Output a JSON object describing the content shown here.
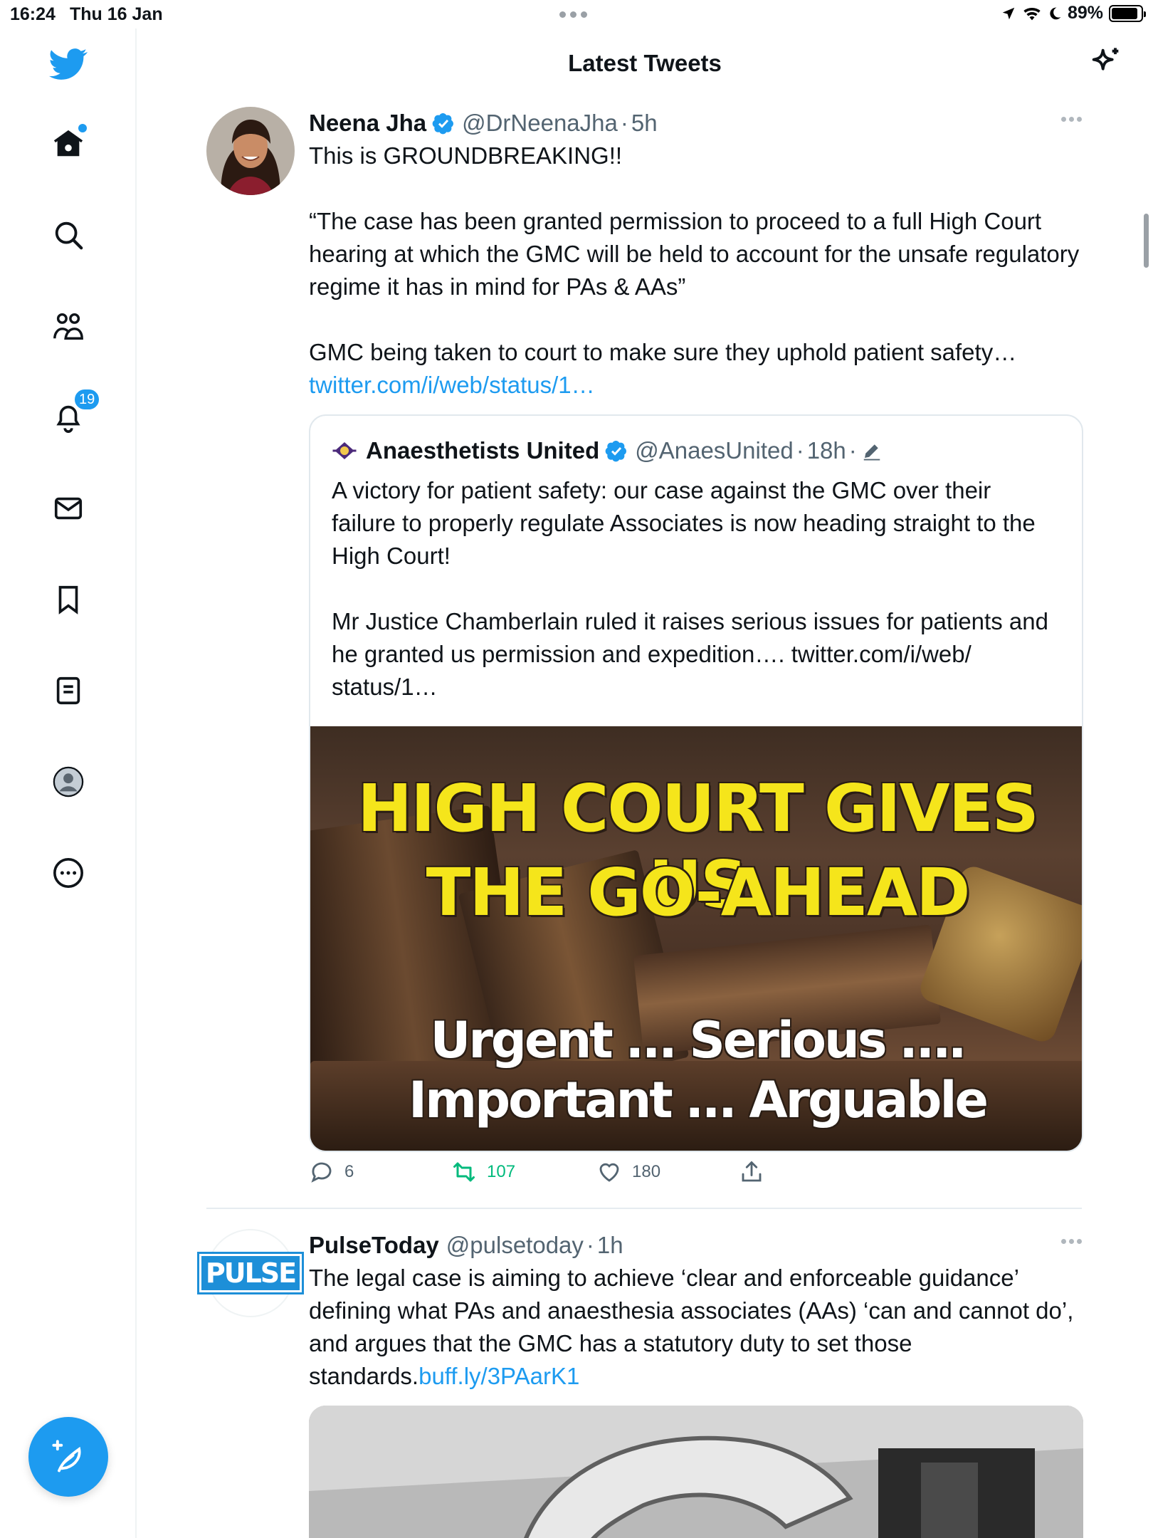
{
  "status_bar": {
    "time": "16:24",
    "date": "Thu 16 Jan",
    "battery": "89%",
    "battery_level": 0.89
  },
  "header": {
    "title": "Latest Tweets"
  },
  "sidebar": {
    "items": [
      {
        "name": "home",
        "icon": "home-icon"
      },
      {
        "name": "explore",
        "icon": "search-icon"
      },
      {
        "name": "communities",
        "icon": "communities-icon"
      },
      {
        "name": "notifications",
        "icon": "bell-icon",
        "badge": "19"
      },
      {
        "name": "messages",
        "icon": "mail-icon"
      },
      {
        "name": "bookmarks",
        "icon": "bookmark-icon"
      },
      {
        "name": "lists",
        "icon": "list-icon"
      },
      {
        "name": "profile",
        "icon": "profile-icon"
      },
      {
        "name": "more",
        "icon": "more-circle-icon"
      }
    ]
  },
  "tweets": [
    {
      "name": "Neena Jha",
      "handle": "@DrNeenaJha",
      "sep": "·",
      "time": "5h",
      "text": "This is GROUNDBREAKING!!\n\n“The case has been granted permission to proceed to a full High Court hearing at which the GMC will be held to account for the unsafe regulatory regime it has in mind for PAs & AAs”\n\nGMC being taken to court to make sure they uphold patient safety…",
      "link": "twitter.com/i/web/status/1…",
      "quote": {
        "name": "Anaesthetists United",
        "handle": "@AnaesUnited",
        "sep": "·",
        "time": "18h",
        "sep2": "·",
        "text": "A victory for patient safety: our case against the GMC over their failure to properly regulate Associates is now heading straight to the High Court!\n\nMr Justice Chamberlain ruled it raises serious issues for patients and he granted us permission and expedition…. twitter.com/i/web/\nstatus/1…",
        "image": {
          "line1": "HIGH COURT GIVES US",
          "line2": "THE GO-AHEAD",
          "sub1": "Urgent … Serious ….",
          "sub2": "Important … Arguable"
        }
      },
      "replies": "6",
      "retweets": "107",
      "likes": "180"
    },
    {
      "name": "PulseToday",
      "handle": "@pulsetoday",
      "sep": "·",
      "time": "1h",
      "logo_text": "PULSE",
      "text": "The legal case is aiming to achieve ‘clear and enforceable guidance’ defining what PAs and anaesthesia associates (AAs) ‘can and cannot do’, and argues that the GMC has a statutory duty to set those standards.",
      "link": "buff.ly/3PAarK1"
    }
  ],
  "colors": {
    "accent": "#1d9bf0",
    "retweet": "#00ba7c",
    "muted": "#536471"
  }
}
